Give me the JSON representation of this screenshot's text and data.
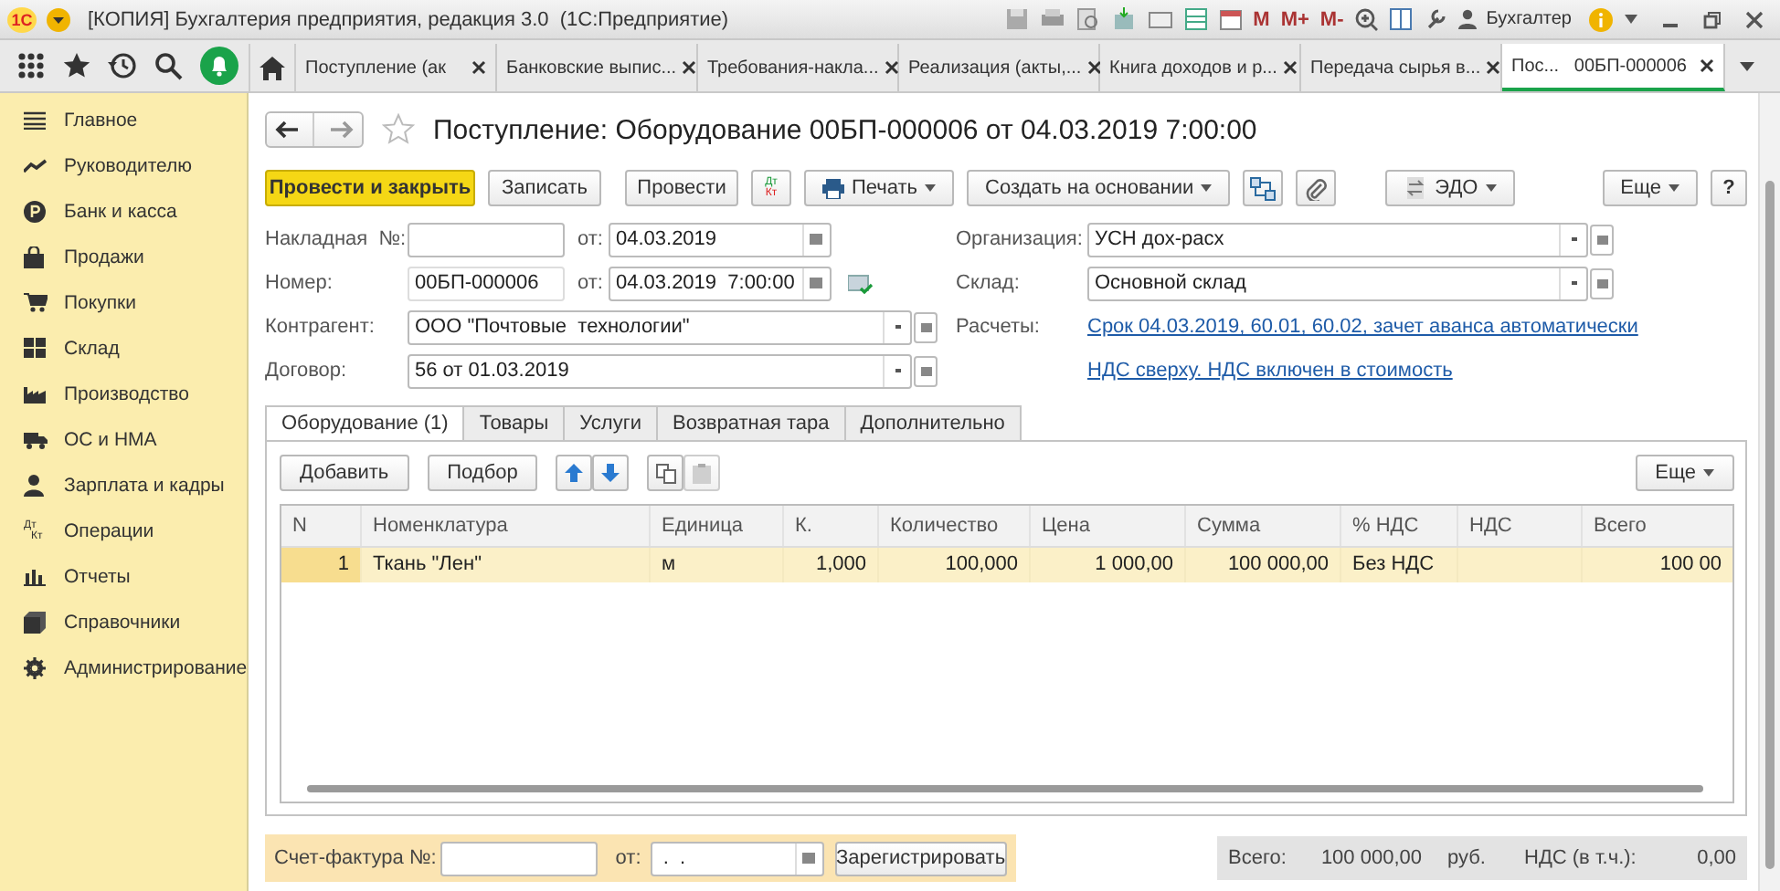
{
  "title_bar": {
    "logo": "1С",
    "title": "[КОПИЯ] Бухгалтерия предприятия, редакция 3.0  (1С:Предприятие)",
    "memory_buttons": [
      "M",
      "M+",
      "M-"
    ],
    "user": "Бухгалтер"
  },
  "open_tabs": [
    {
      "label": "Поступление (ак",
      "selected": false
    },
    {
      "label": "Банковские выпис...",
      "selected": false
    },
    {
      "label": "Требования-накла...",
      "selected": false
    },
    {
      "label": "Реализация (акты,...",
      "selected": false
    },
    {
      "label": "Книга доходов и р...",
      "selected": false
    },
    {
      "label": "Передача сырья в...",
      "selected": false
    },
    {
      "label": "Пос...   00БП-000006",
      "selected": true
    }
  ],
  "sidebar": {
    "items": [
      {
        "label": "Главное",
        "kind": "menu"
      },
      {
        "label": "Руководителю",
        "kind": "trend"
      },
      {
        "label": "Банк и касса",
        "kind": "coin"
      },
      {
        "label": "Продажи",
        "kind": "bag"
      },
      {
        "label": "Покупки",
        "kind": "cart"
      },
      {
        "label": "Склад",
        "kind": "grid"
      },
      {
        "label": "Производство",
        "kind": "factory"
      },
      {
        "label": "ОС и НМА",
        "kind": "truck"
      },
      {
        "label": "Зарплата и кадры",
        "kind": "person"
      },
      {
        "label": "Операции",
        "kind": "dtkt",
        "icon_text": [
          "Дт",
          "Кт"
        ]
      },
      {
        "label": "Отчеты",
        "kind": "bars"
      },
      {
        "label": "Справочники",
        "kind": "books"
      },
      {
        "label": "Администрирование",
        "kind": "gear"
      }
    ]
  },
  "document": {
    "title": "Поступление: Оборудование 00БП-000006 от 04.03.2019 7:00:00",
    "favorite": false,
    "toolbar": {
      "primary": "Провести и закрыть",
      "save": "Записать",
      "post": "Провести",
      "dtkt": [
        "Дт",
        "Кт"
      ],
      "print": "Печать",
      "create_based": "Создать на основании",
      "edo": "ЭДО",
      "more": "Еще",
      "help": "?"
    },
    "invoice": {
      "label": "Накладная  №:",
      "date_label": "от:",
      "date": "04.03.2019"
    },
    "number": {
      "label": "Номер:",
      "value": "00БП-000006",
      "date_label": "от:",
      "date": "04.03.2019  7:00:00"
    },
    "counterparty": {
      "label": "Контрагент:",
      "value": "ООО \"Почтовые  технологии\""
    },
    "contract": {
      "label": "Договор:",
      "value": "56 от 01.03.2019"
    },
    "organization": {
      "label": "Организация:",
      "value": "УСН дох-расх"
    },
    "warehouse": {
      "label": "Склад:",
      "value": "Основной склад"
    },
    "settlements": {
      "label": "Расчеты:",
      "link": "Срок 04.03.2019, 60.01, 60.02, зачет аванса автоматически"
    },
    "vat_link": "НДС сверху. НДС включен в стоимость",
    "tabs": [
      {
        "label": "Оборудование (1)",
        "selected": true
      },
      {
        "label": "Товары",
        "selected": false
      },
      {
        "label": "Услуги",
        "selected": false
      },
      {
        "label": "Возвратная тара",
        "selected": false
      },
      {
        "label": "Дополнительно",
        "selected": false
      }
    ],
    "table_toolbar": {
      "add": "Добавить",
      "pick": "Подбор",
      "more": "Еще"
    },
    "table": {
      "columns": [
        "N",
        "Номенклатура",
        "Единица",
        "К.",
        "Количество",
        "Цена",
        "Сумма",
        "% НДС",
        "НДС",
        "Всего"
      ],
      "rows": [
        {
          "selected": true,
          "cells": [
            "1",
            "Ткань \"Лен\"",
            "м",
            "1,000",
            "100,000",
            "1 000,00",
            "100 000,00",
            "Без НДС",
            "",
            "100 00"
          ]
        }
      ]
    },
    "footer": {
      "invoice_label": "Счет-фактура №:",
      "date_label": "от:",
      "date_value": " .  .",
      "register": "Зарегистрировать",
      "total_label": "Всего:",
      "total": "100 000,00",
      "currency": "руб.",
      "vat_label": "НДС (в т.ч.):",
      "vat": "0,00"
    }
  }
}
